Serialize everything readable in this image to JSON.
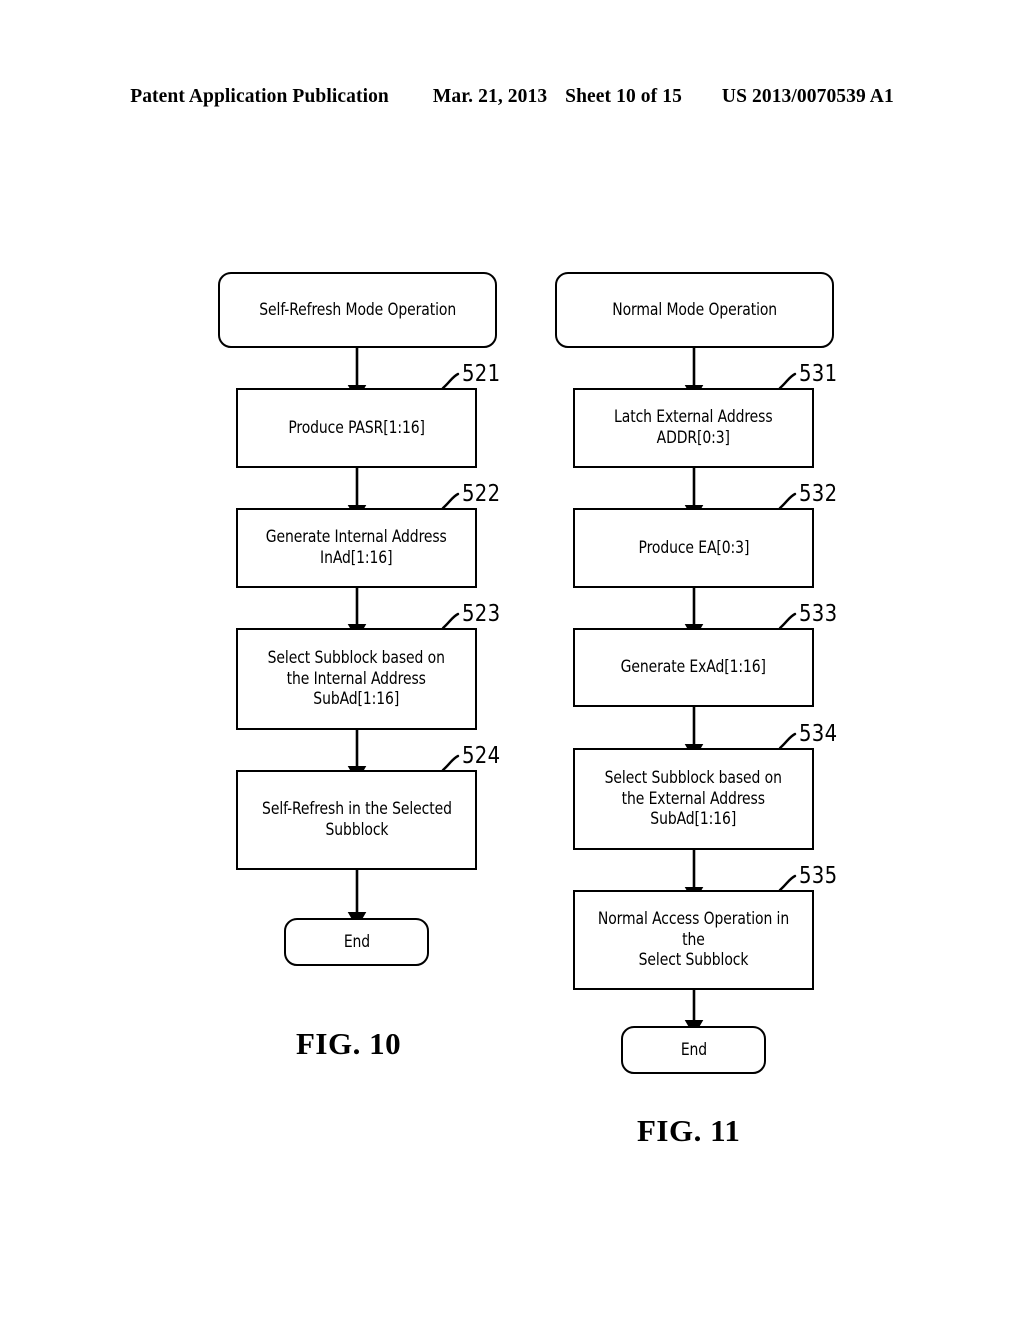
{
  "header": {
    "publication": "Patent Application Publication",
    "date": "Mar. 21, 2013",
    "sheet": "Sheet 10 of 15",
    "patent_number": "US 2013/0070539 A1"
  },
  "figures": [
    {
      "caption": "FIG. 10",
      "nodes": [
        {
          "id": "start-left",
          "type": "terminal",
          "label": "Self-Refresh Mode Operation",
          "ref": null
        },
        {
          "id": "step-521",
          "type": "process",
          "label": "Produce PASR[1:16]",
          "ref": "521"
        },
        {
          "id": "step-522",
          "type": "process",
          "label": "Generate Internal Address\nInAd[1:16]",
          "ref": "522"
        },
        {
          "id": "step-523",
          "type": "process",
          "label": "Select Subblock based on\nthe Internal Address\nSubAd[1:16]",
          "ref": "523"
        },
        {
          "id": "step-524",
          "type": "process",
          "label": "Self-Refresh in the Selected\nSubblock",
          "ref": "524"
        },
        {
          "id": "end-left",
          "type": "terminal",
          "label": "End",
          "ref": null
        }
      ]
    },
    {
      "caption": "FIG. 11",
      "nodes": [
        {
          "id": "start-right",
          "type": "terminal",
          "label": "Normal Mode Operation",
          "ref": null
        },
        {
          "id": "step-531",
          "type": "process",
          "label": "Latch External Address\nADDR[0:3]",
          "ref": "531"
        },
        {
          "id": "step-532",
          "type": "process",
          "label": "Produce EA[0:3]",
          "ref": "532"
        },
        {
          "id": "step-533",
          "type": "process",
          "label": "Generate ExAd[1:16]",
          "ref": "533"
        },
        {
          "id": "step-534",
          "type": "process",
          "label": "Select Subblock based on\nthe External Address\nSubAd[1:16]",
          "ref": "534"
        },
        {
          "id": "step-535",
          "type": "process",
          "label": "Normal Access Operation in the\nSelect Subblock",
          "ref": "535"
        },
        {
          "id": "end-right",
          "type": "terminal",
          "label": "End",
          "ref": null
        }
      ]
    }
  ],
  "colors": {
    "ink": "#000000",
    "paper": "#ffffff"
  }
}
